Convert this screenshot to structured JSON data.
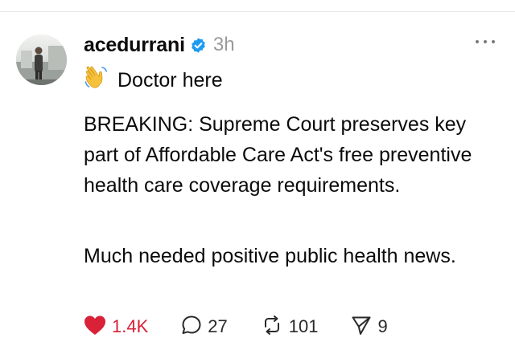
{
  "post": {
    "username": "acedurrani",
    "verified": true,
    "timestamp": "3h",
    "intro_text": "Doctor here",
    "intro_icon": "waving-hand-emoji",
    "paragraphs": [
      "BREAKING: Supreme Court preserves key part of Affordable Care Act's free preventive health care coverage requirements.",
      "Much needed positive public health news."
    ],
    "actions": {
      "likes": "1.4K",
      "replies": "27",
      "reposts": "101",
      "shares": "9"
    }
  },
  "colors": {
    "like": "#d92138",
    "verified": "#1d9bf0",
    "muted": "#9a9a9a"
  }
}
